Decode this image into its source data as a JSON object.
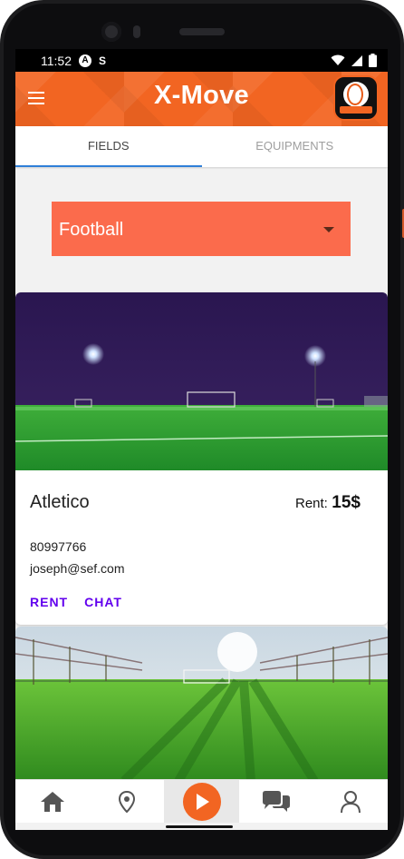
{
  "status_bar": {
    "time": "11:52",
    "icon_a": "A",
    "icon_s": "S"
  },
  "app_bar": {
    "title": "X-Move",
    "logo_icon": "volleyball-logo"
  },
  "tabs": [
    {
      "label": "FIELDS",
      "active": true
    },
    {
      "label": "EQUIPMENTS",
      "active": false
    }
  ],
  "filter": {
    "selected": "Football"
  },
  "cards": [
    {
      "name": "Atletico",
      "rent_label": "Rent:",
      "rent_price": "15$",
      "phone": "80997766",
      "email": "joseph@sef.com",
      "actions": [
        "RENT",
        "CHAT"
      ]
    }
  ],
  "bottom_nav": [
    {
      "icon": "home-icon"
    },
    {
      "icon": "location-pin-icon"
    },
    {
      "icon": "play-icon",
      "active": true
    },
    {
      "icon": "chat-icon"
    },
    {
      "icon": "profile-icon"
    }
  ],
  "colors": {
    "primary": "#f26522",
    "dropdown": "#fb6b4c",
    "tab_indicator": "#2f7fd8",
    "action_text": "#6200ee"
  }
}
